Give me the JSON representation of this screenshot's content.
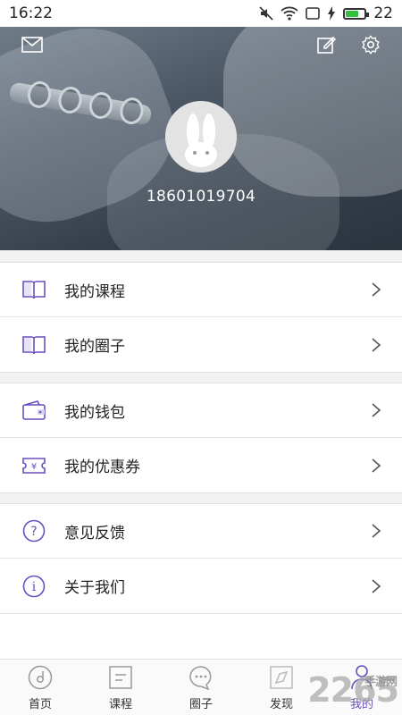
{
  "status_bar": {
    "time": "16:22",
    "battery": "22"
  },
  "profile": {
    "phone": "18601019704"
  },
  "menu": {
    "group1": [
      {
        "label": "我的课程",
        "icon": "book-icon"
      },
      {
        "label": "我的圈子",
        "icon": "book-icon"
      }
    ],
    "group2": [
      {
        "label": "我的钱包",
        "icon": "wallet-icon"
      },
      {
        "label": "我的优惠券",
        "icon": "coupon-icon"
      }
    ],
    "group3": [
      {
        "label": "意见反馈",
        "icon": "question-icon"
      },
      {
        "label": "关于我们",
        "icon": "info-icon"
      }
    ]
  },
  "tabs": [
    {
      "label": "首页",
      "icon": "music-disc-icon"
    },
    {
      "label": "课程",
      "icon": "document-icon"
    },
    {
      "label": "圈子",
      "icon": "chat-bubble-icon"
    },
    {
      "label": "发现",
      "icon": "discover-icon"
    },
    {
      "label": "我的",
      "icon": "person-icon",
      "active": true
    }
  ],
  "watermark": {
    "text": "2265",
    "sub": "手游网"
  },
  "colors": {
    "accent": "#6a4fbf",
    "text": "#222222",
    "divider": "#e5e5e5"
  }
}
